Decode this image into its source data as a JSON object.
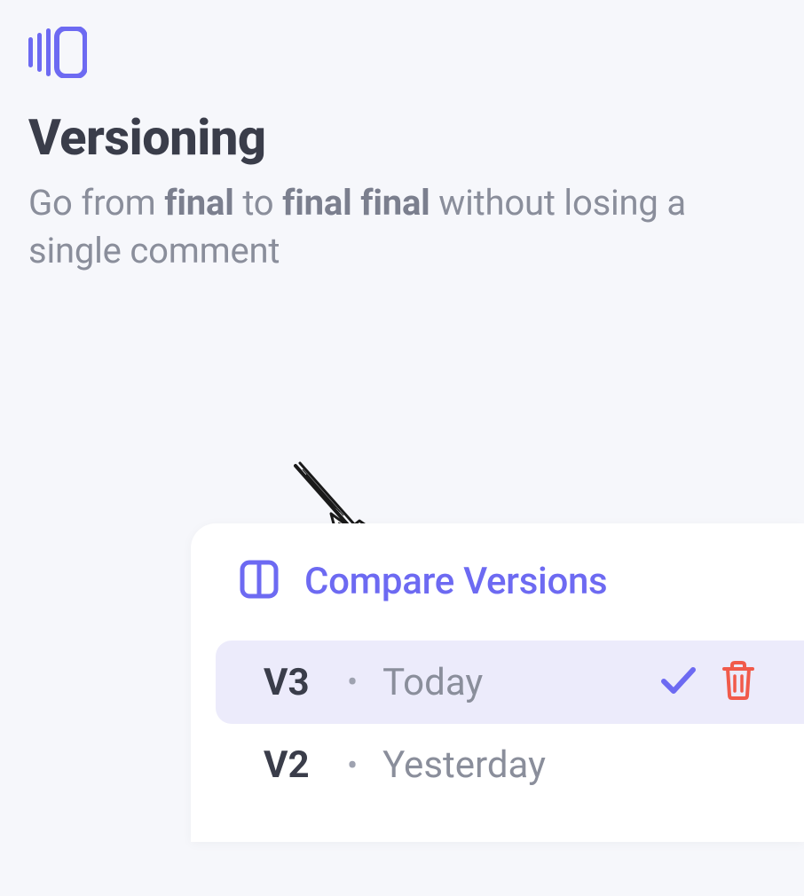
{
  "colors": {
    "accent": "#6d6af2",
    "text_dark": "#3a3d4a",
    "text_muted": "#8a8e9b",
    "selected_bg": "#ecebfb",
    "delete": "#f15a4a"
  },
  "header": {
    "icon": "versioning-icon",
    "title": "Versioning",
    "subtitle_parts": {
      "p1": "Go from ",
      "b1": "final",
      "p2": " to ",
      "b2": "final final",
      "p3": " without losing a single comment"
    }
  },
  "card": {
    "compare_label": "Compare Versions",
    "versions": [
      {
        "id": "V3",
        "date": "Today",
        "selected": true,
        "checked": true,
        "deleteable": true
      },
      {
        "id": "V2",
        "date": "Yesterday",
        "selected": false,
        "checked": false,
        "deleteable": false
      }
    ]
  }
}
